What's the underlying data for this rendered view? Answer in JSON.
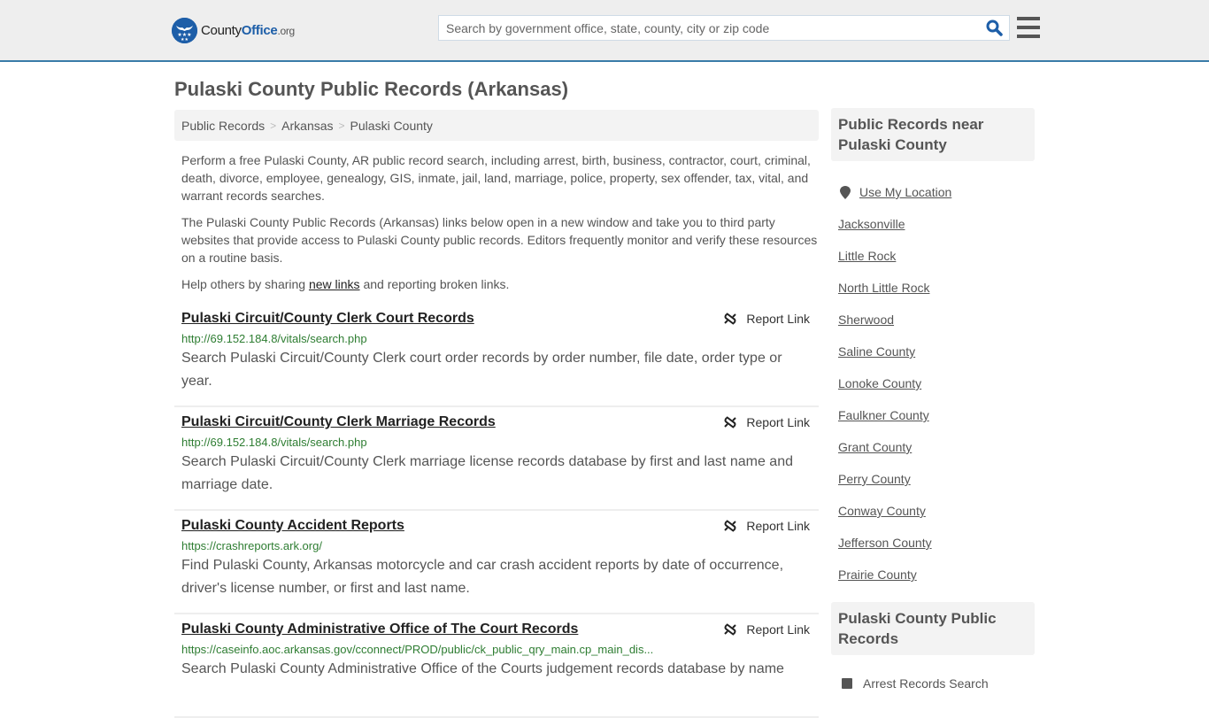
{
  "header": {
    "logo": {
      "name_part1": "County",
      "name_part2": "Office",
      "tld": ".org",
      "brand_color": "#1d5ea8"
    },
    "search": {
      "placeholder": "Search by government office, state, county, city or zip code",
      "value": ""
    },
    "accent_color": "#3a7ca8"
  },
  "page": {
    "title": "Pulaski County Public Records (Arkansas)",
    "breadcrumb": [
      {
        "label": "Public Records"
      },
      {
        "label": "Arkansas"
      },
      {
        "label": "Pulaski County"
      }
    ],
    "breadcrumb_separator": ">",
    "intro": {
      "p1": "Perform a free Pulaski County, AR public record search, including arrest, birth, business, contractor, court, criminal, death, divorce, employee, genealogy, GIS, inmate, jail, land, marriage, police, property, sex offender, tax, vital, and warrant records searches.",
      "p2": "The Pulaski County Public Records (Arkansas) links below open in a new window and take you to third party websites that provide access to Pulaski County public records. Editors frequently monitor and verify these resources on a routine basis.",
      "p3_before": "Help others by sharing ",
      "p3_link": "new links",
      "p3_after": " and reporting broken links."
    }
  },
  "records": [
    {
      "title": "Pulaski Circuit/County Clerk Court Records",
      "url": "http://69.152.184.8/vitals/search.php",
      "description": "Search Pulaski Circuit/County Clerk court order records by order number, file date, order type or year.",
      "report_label": "Report Link"
    },
    {
      "title": "Pulaski Circuit/County Clerk Marriage Records",
      "url": "http://69.152.184.8/vitals/search.php",
      "description": "Search Pulaski Circuit/County Clerk marriage license records database by first and last name and marriage date.",
      "report_label": "Report Link"
    },
    {
      "title": "Pulaski County Accident Reports",
      "url": "https://crashreports.ark.org/",
      "description": "Find Pulaski County, Arkansas motorcycle and car crash accident reports by date of occurrence, driver's license number, or first and last name.",
      "report_label": "Report Link"
    },
    {
      "title": "Pulaski County Administrative Office of The Court Records",
      "url": "https://caseinfo.aoc.arkansas.gov/cconnect/PROD/public/ck_public_qry_main.cp_main_dis...",
      "description": "Search Pulaski County Administrative Office of the Courts judgement records database by name",
      "report_label": "Report Link"
    }
  ],
  "sidebar": {
    "nearby": {
      "heading": "Public Records near Pulaski County",
      "use_location": "Use My Location",
      "items": [
        "Jacksonville",
        "Little Rock",
        "North Little Rock",
        "Sherwood",
        "Saline County",
        "Lonoke County",
        "Faulkner County",
        "Grant County",
        "Perry County",
        "Conway County",
        "Jefferson County",
        "Prairie County"
      ]
    },
    "county_records": {
      "heading": "Pulaski County Public Records",
      "items": [
        "Arrest Records Search"
      ]
    }
  }
}
